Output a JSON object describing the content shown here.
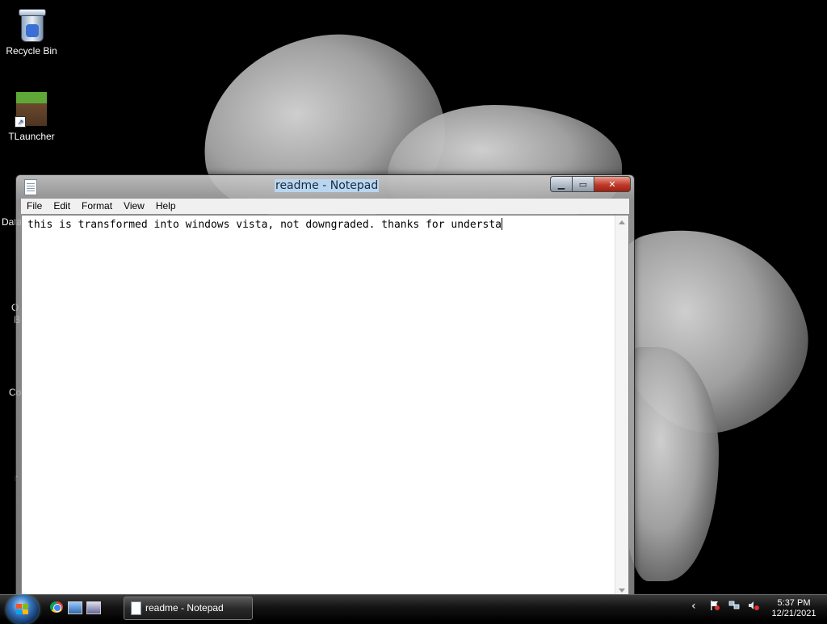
{
  "desktop": {
    "icons": [
      {
        "label": "Recycle Bin",
        "icon": "recycle-bin-icon"
      },
      {
        "label": "TLauncher",
        "icon": "minecraft-grass-block-icon"
      }
    ],
    "partial_labels": [
      "Data",
      "O",
      "B",
      "Co",
      "r"
    ]
  },
  "window": {
    "title": "readme - Notepad",
    "icon": "notepad-icon",
    "controls": {
      "minimize": "minimize-icon",
      "maximize": "maximize-icon",
      "close": "close-icon"
    },
    "menu": [
      "File",
      "Edit",
      "Format",
      "View",
      "Help"
    ],
    "content": "this is transformed into windows vista, not downgraded. thanks for understa"
  },
  "taskbar": {
    "start": "start-orb-icon",
    "quick_launch": [
      "chrome-icon",
      "show-desktop-icon",
      "switch-windows-icon"
    ],
    "tasks": [
      {
        "label": "readme - Notepad",
        "icon": "notepad-icon"
      }
    ],
    "tray_icons": [
      "show-hidden-icons-arrow",
      "action-center-flag-icon",
      "network-icon",
      "volume-muted-icon"
    ],
    "clock": {
      "time": "5:37 PM",
      "date": "12/21/2021"
    }
  },
  "colors": {
    "title_highlight": "#b8d6f0",
    "close_button": "#c0392b",
    "taskbar": "#151515"
  }
}
